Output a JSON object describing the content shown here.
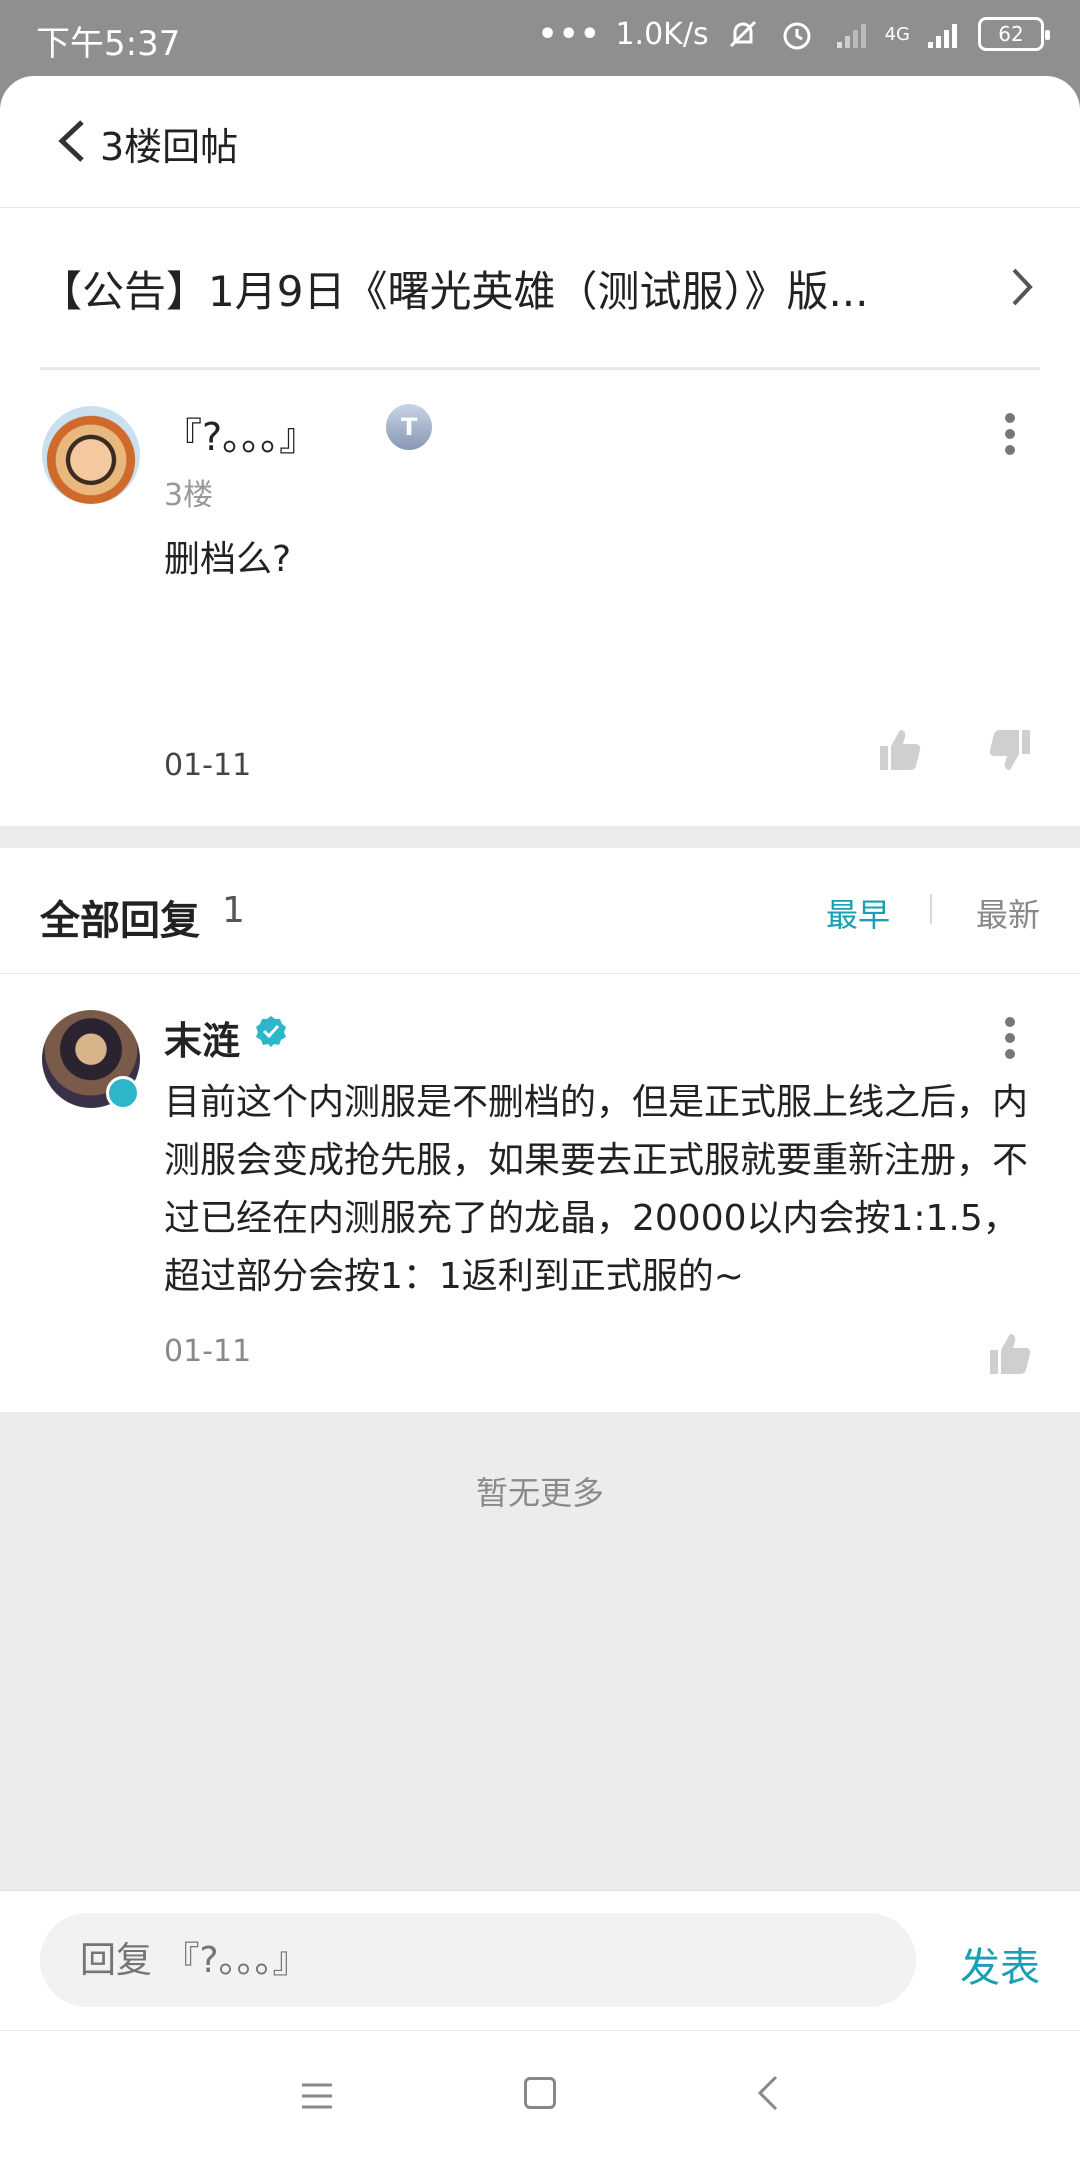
{
  "status_bar": {
    "time": "下午5:37",
    "net_speed": "1.0K/s",
    "network_type": "4G",
    "battery": "62"
  },
  "header": {
    "title": "3楼回帖"
  },
  "thread": {
    "title": "【公告】1月9日《曙光英雄（测试服）》版..."
  },
  "post": {
    "author": "『?。。。』",
    "badge": "T",
    "floor": "3楼",
    "content": "删档么?",
    "date": "01-11"
  },
  "replies": {
    "label": "全部回复",
    "count": "1",
    "sort_earliest": "最早",
    "sort_newest": "最新",
    "items": [
      {
        "name": "末涟",
        "content": "目前这个内测服是不删档的，但是正式服上线之后，内测服会变成抢先服，如果要去正式服就要重新注册，不过已经在内测服充了的龙晶，20000以内会按1:1.5，超过部分会按1：1返利到正式服的~",
        "date": "01-11"
      }
    ],
    "no_more": "暂无更多"
  },
  "composer": {
    "placeholder": "回复 『?。。。』",
    "send_label": "发表"
  },
  "colors": {
    "accent": "#1a9fb3",
    "status_bar": "#8f8f8f",
    "section_gap": "#ececec"
  }
}
